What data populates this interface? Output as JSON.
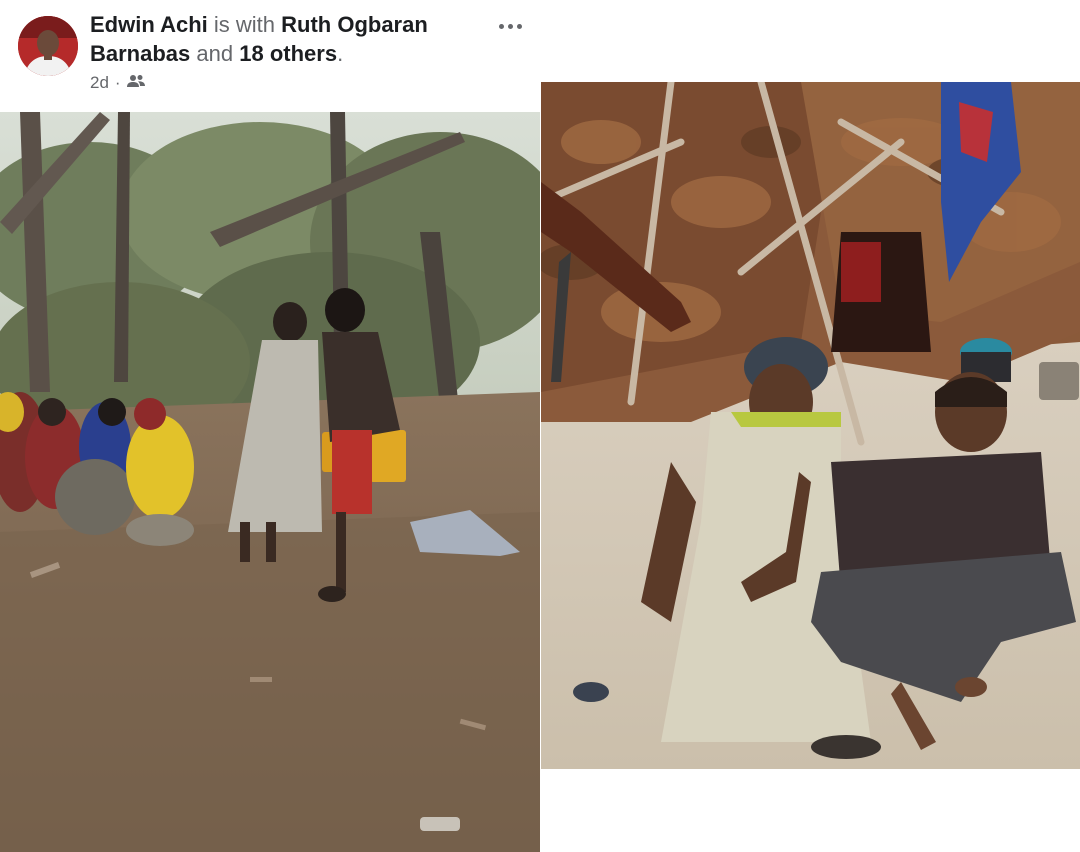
{
  "post": {
    "author": "Edwin Achi",
    "with_text": "is with",
    "tagged": "Ruth Ogbaran Barnabas",
    "and_text": "and",
    "others": "18 others",
    "period": ".",
    "time": "2d",
    "separator": "·",
    "audience_icon": "friends-icon",
    "more_icon": "more-options-icon"
  },
  "photos": [
    {
      "id": "photo-1",
      "scene": "group-in-forest-clearing"
    },
    {
      "id": "photo-2",
      "scene": "two-women-seated-by-hut"
    }
  ],
  "colors": {
    "name_text": "#1c1e21",
    "secondary_text": "#65676b",
    "avatar_bg": "#b52a2a"
  }
}
